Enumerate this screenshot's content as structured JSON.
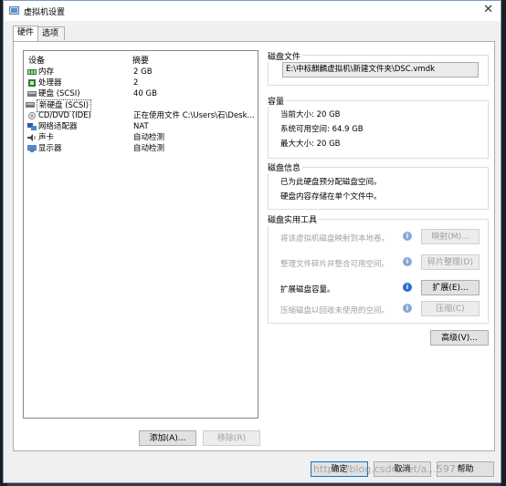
{
  "window": {
    "title": "虚拟机设置",
    "close_glyph": "✕"
  },
  "tabs": [
    {
      "label": "硬件"
    },
    {
      "label": "选项"
    }
  ],
  "device_list": {
    "headers": {
      "device": "设备",
      "summary": "摘要"
    },
    "rows": [
      {
        "name": "内存",
        "summary": "2 GB",
        "icon": "memory-icon",
        "color": "#3a7d3a"
      },
      {
        "name": "处理器",
        "summary": "2",
        "icon": "processor-icon",
        "color": "#2e7d32"
      },
      {
        "name": "硬盘 (SCSI)",
        "summary": "40 GB",
        "icon": "hard-disk-icon",
        "color": "#666666"
      },
      {
        "name": "新硬盘 (SCSI)",
        "summary": "",
        "icon": "new-hard-disk-icon",
        "color": "#666666"
      },
      {
        "name": "CD/DVD (IDE)",
        "summary": "正在使用文件 C:\\Users\\石\\Desk...",
        "icon": "cd-dvd-icon",
        "color": "#888888"
      },
      {
        "name": "网络适配器",
        "summary": "NAT",
        "icon": "network-adapter-icon",
        "color": "#2a5aa8"
      },
      {
        "name": "声卡",
        "summary": "自动检测",
        "icon": "sound-card-icon",
        "color": "#444444"
      },
      {
        "name": "显示器",
        "summary": "自动检测",
        "icon": "display-icon",
        "color": "#2a5aa8"
      }
    ],
    "selected_index": 3
  },
  "list_buttons": {
    "add": "添加(A)...",
    "remove": "移除(R)"
  },
  "disk_file": {
    "title": "磁盘文件",
    "path": "E:\\中标麒麟虚拟机\\新建文件夹\\DSC.vmdk"
  },
  "capacity": {
    "title": "容量",
    "current_size": "当前大小: 20 GB",
    "free_space": "系统可用空间: 64.9 GB",
    "max_size": "最大大小: 20 GB"
  },
  "disk_info": {
    "title": "磁盘信息",
    "line1": "已为此硬盘预分配磁盘空间。",
    "line2": "硬盘内容存储在单个文件中。"
  },
  "disk_utilities": {
    "title": "磁盘实用工具",
    "items": [
      {
        "text": "将该虚拟机磁盘映射到本地卷。",
        "button": "映射(M)...",
        "enabled": false
      },
      {
        "text": "整理文件碎片并整合可用空间。",
        "button": "碎片整理(D)",
        "enabled": false
      },
      {
        "text": "扩展磁盘容量。",
        "button": "扩展(E)...",
        "enabled": true
      },
      {
        "text": "压缩磁盘以回收未使用的空间。",
        "button": "压缩(C)",
        "enabled": false
      }
    ]
  },
  "advanced_button": "高级(V)...",
  "footer": {
    "ok": "确定",
    "cancel": "取消",
    "help": "帮助"
  },
  "watermark": "https://blog.csdn.net/a...597",
  "colors": {
    "accent": "#0078d7",
    "disabled_text": "#a0a0a0",
    "info_icon": "#2a6ecf"
  }
}
